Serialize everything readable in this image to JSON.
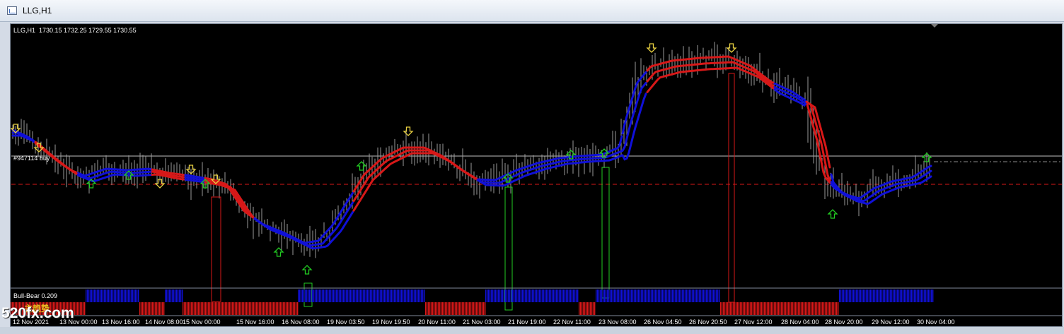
{
  "window": {
    "title": "LLG,H1",
    "icon": "chart-window-icon"
  },
  "chart": {
    "symbol_line": "LLG,H1  1730.15 1732.25 1729.55 1730.55",
    "trade_label": "#947114 buy",
    "indicator_label": "Bull-Bear 0.209",
    "watermark": "520fx.com",
    "watermark_zh": "主趋势",
    "x_labels": [
      "12 Nov 2021",
      "13 Nov 00:00",
      "13 Nov 16:00",
      "14 Nov 08:00",
      "15 Nov 00:00",
      "15 Nov 16:00",
      "16 Nov 08:00",
      "19 Nov 03:50",
      "19 Nov 19:50",
      "20 Nov 11:00",
      "21 Nov 03:00",
      "21 Nov 19:00",
      "22 Nov 11:00",
      "23 Nov 08:00",
      "26 Nov 04:50",
      "26 Nov 20:50",
      "27 Nov 12:00",
      "28 Nov 04:00",
      "28 Nov 20:00",
      "29 Nov 12:00",
      "30 Nov 04:00"
    ],
    "colors": {
      "background": "#000000",
      "bull": "#1010d8",
      "bear": "#d81818",
      "candle": "#9a9a9a",
      "up_arrow": "#22cc22",
      "down_arrow": "#e8d040",
      "trade_line": "#c0c0c0",
      "stop_line": "#d81818"
    }
  }
}
